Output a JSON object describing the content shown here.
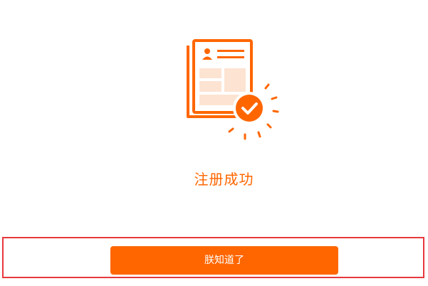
{
  "illustration": {
    "icon": "registration-success-icon"
  },
  "message": {
    "title": "注册成功"
  },
  "action": {
    "button_label": "朕知道了"
  },
  "colors": {
    "accent": "#ff6600",
    "accent_light": "#fde3d2",
    "highlight_border": "#e8383d"
  }
}
